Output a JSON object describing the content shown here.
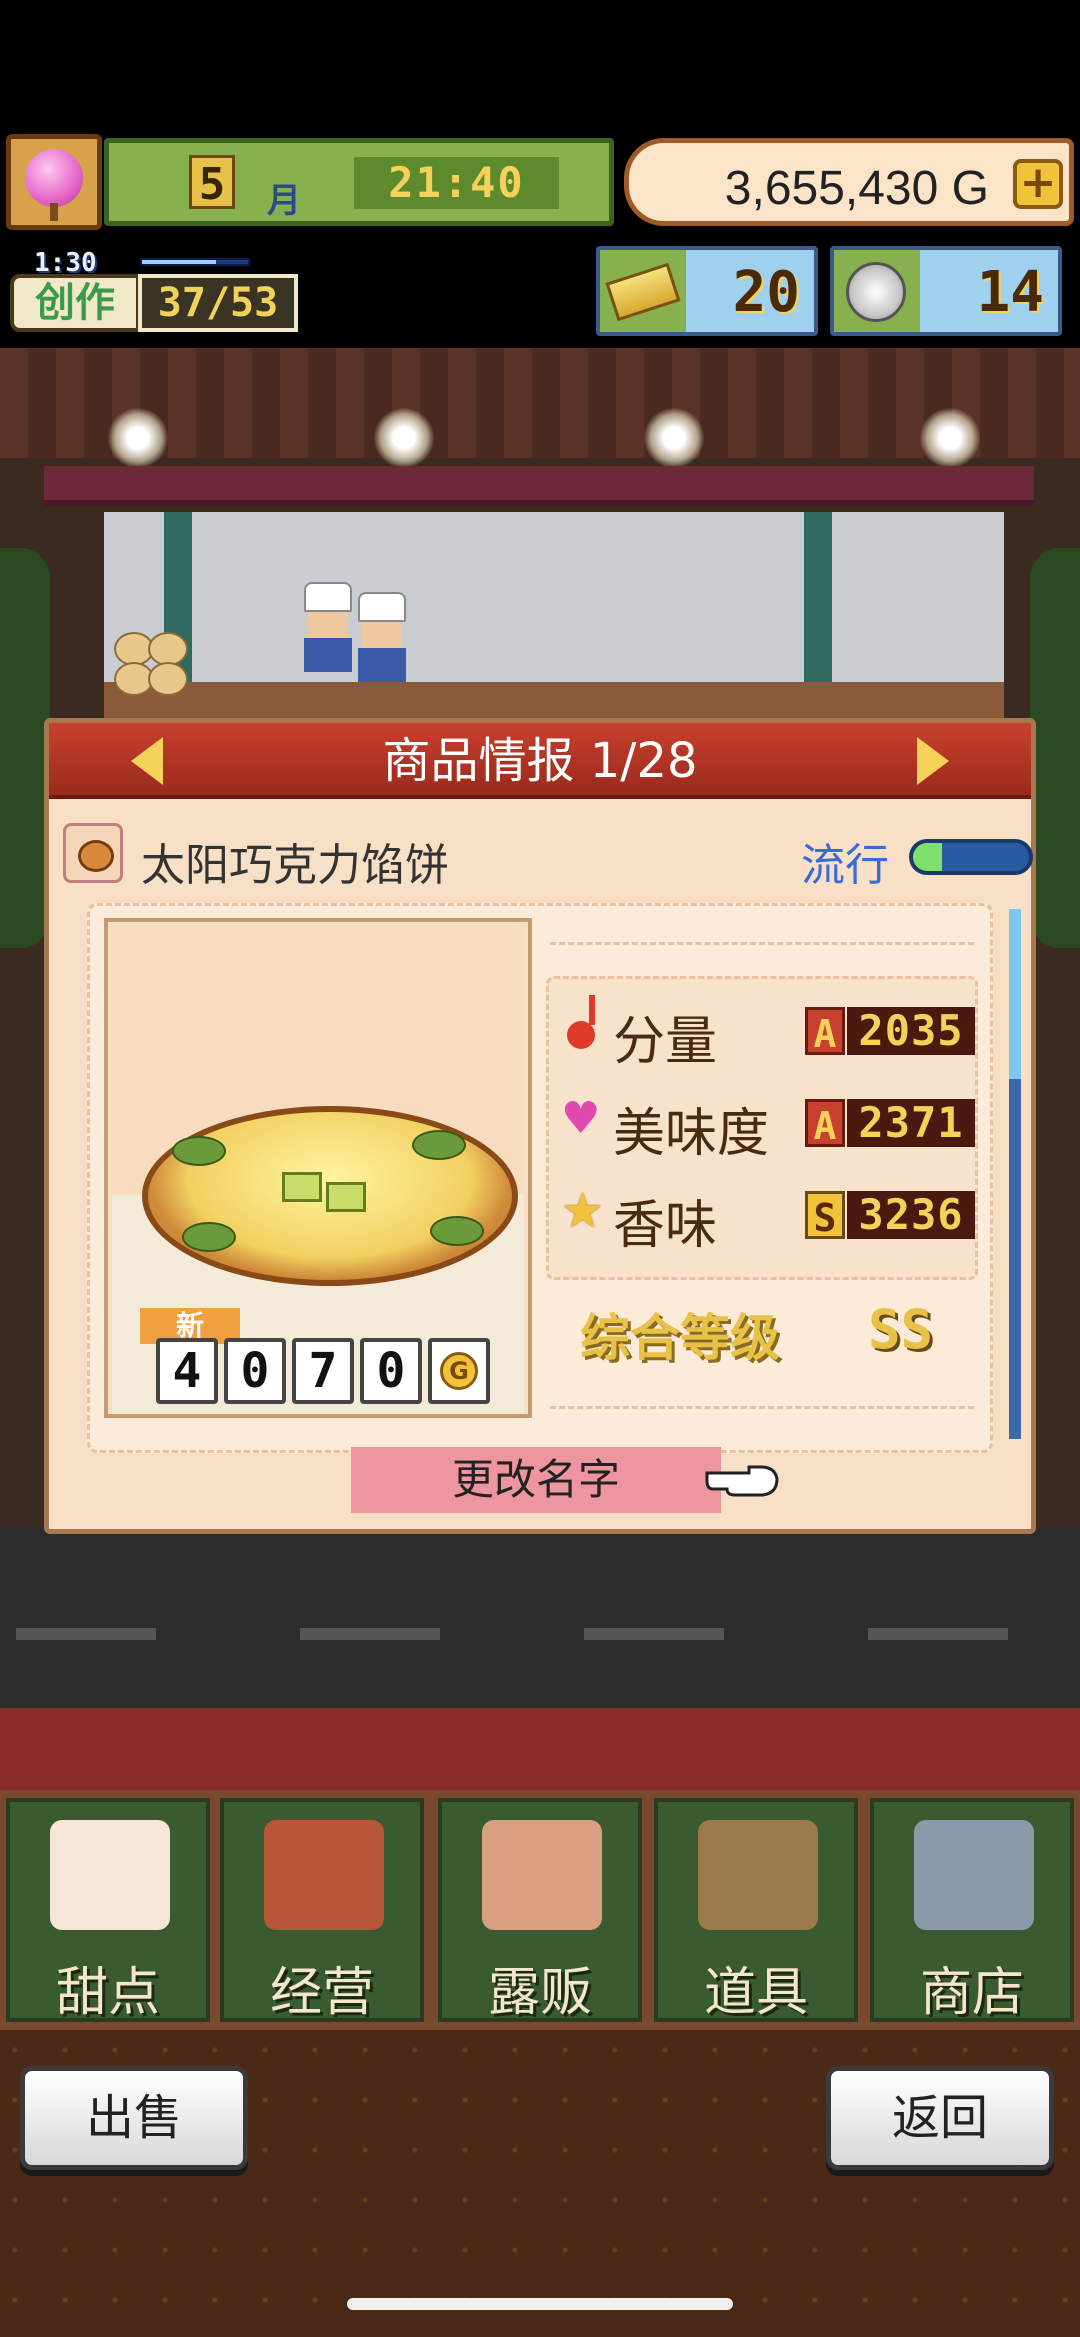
{
  "hud": {
    "month": "5",
    "month_label": "月",
    "time": "21:40",
    "gold": "3,655,430 G",
    "plus_symbol": "+",
    "create_timer": "1:30",
    "create_progress": 0.7,
    "create_label": "创作",
    "create_count": "37/53",
    "tickets": "20",
    "medals": "14"
  },
  "dialog": {
    "title": "商品情报 1/28",
    "product_name": "太阳巧克力馅饼",
    "trend_label": "流行",
    "trend_level": 0.25,
    "new_tag": "新",
    "price_digits": [
      "4",
      "0",
      "7",
      "0"
    ],
    "price_unit": "G",
    "stats": [
      {
        "icon": "music-note-icon",
        "label": "分量",
        "grade": "A",
        "value": "2035"
      },
      {
        "icon": "heart-icon",
        "label": "美味度",
        "grade": "A",
        "value": "2371"
      },
      {
        "icon": "star-icon",
        "label": "香味",
        "grade": "S",
        "value": "3236"
      }
    ],
    "overall_label": "综合等级",
    "overall_grade": "SS",
    "rename_button": "更改名字"
  },
  "menu": [
    {
      "label": "甜点",
      "icon": "cake-icon"
    },
    {
      "label": "经营",
      "icon": "shop-icon"
    },
    {
      "label": "露贩",
      "icon": "food-truck-icon"
    },
    {
      "label": "道具",
      "icon": "gear-bag-icon"
    },
    {
      "label": "商店",
      "icon": "cart-icon"
    }
  ],
  "footer": {
    "sell_button": "出售",
    "back_button": "返回"
  },
  "colors": {
    "header_red": "#b03424",
    "panel_cream": "#f7e0c6",
    "menu_green": "#3a5a30",
    "accent_gold": "#f4d25a"
  }
}
